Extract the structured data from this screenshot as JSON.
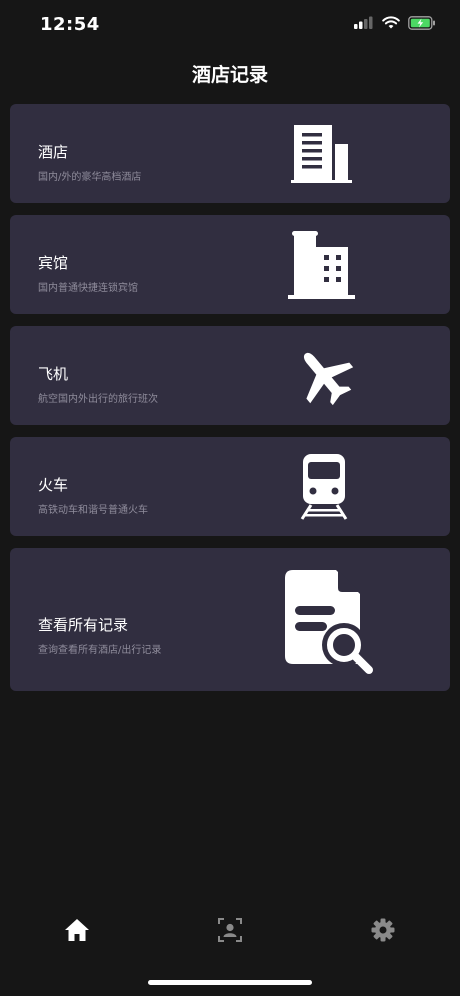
{
  "status_bar": {
    "time": "12:54"
  },
  "header": {
    "title": "酒店记录"
  },
  "cards": [
    {
      "title": "酒店",
      "subtitle": "国内/外的豪华高档酒店",
      "icon": "office-building-icon"
    },
    {
      "title": "宾馆",
      "subtitle": "国内普通快捷连锁宾馆",
      "icon": "city-building-icon"
    },
    {
      "title": "飞机",
      "subtitle": "航空国内外出行的旅行班次",
      "icon": "airplane-icon"
    },
    {
      "title": "火车",
      "subtitle": "高铁动车和谐号普通火车",
      "icon": "train-icon"
    },
    {
      "title": "查看所有记录",
      "subtitle": "查询查看所有酒店/出行记录",
      "icon": "document-search-icon"
    }
  ],
  "tabbar": {
    "items": [
      {
        "icon": "home-icon",
        "active": true
      },
      {
        "icon": "contact-card-icon",
        "active": false
      },
      {
        "icon": "gear-icon",
        "active": false
      }
    ]
  },
  "colors": {
    "background": "#161616",
    "card": "#312e40",
    "subtitle": "#8f8c9b",
    "battery": "#4cd964",
    "inactive_icon": "#8a8a8a"
  }
}
